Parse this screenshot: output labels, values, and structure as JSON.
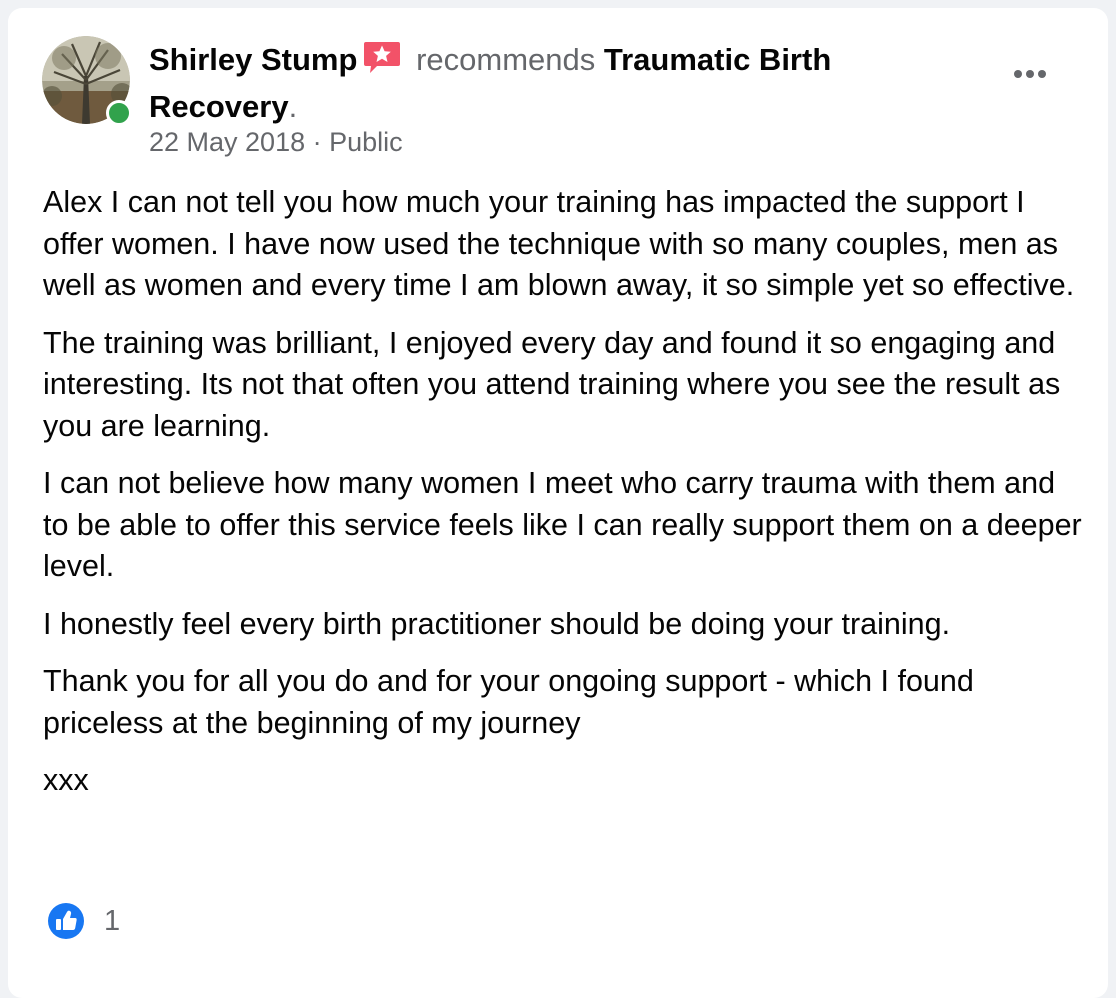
{
  "post": {
    "author": "Shirley Stump",
    "recommends": "recommends",
    "page_name": "Traumatic Birth Recovery",
    "period": ".",
    "date": "22 May 2018",
    "separator": " · ",
    "audience": "Public",
    "paragraphs": [
      "Alex I can not tell you how much your training has impacted the support I offer women. I have now used the technique with so many couples, men as well as women and every time I am blown away, it so simple yet so effective.",
      "The training was brilliant, I enjoyed every day and found it so engaging and interesting. Its not that often you attend training where you see the result as you are learning.",
      "I can not believe how many women I meet who carry trauma with them and to be able to offer this service feels like I can really support them on a deeper level.",
      "I honestly feel every birth practitioner should be doing your training.",
      "Thank you for all you do and for your ongoing support - which I found priceless at the beginning of my journey",
      "xxx"
    ],
    "reaction_count": "1"
  },
  "icons": {
    "badge": "recommendation-star-badge-icon",
    "more": "more-options-icon",
    "like": "like-thumbs-up-icon"
  },
  "colors": {
    "online": "#31a24c",
    "like_blue": "#1877f2",
    "badge_red": "#f25268",
    "secondary_text": "#65676b"
  }
}
